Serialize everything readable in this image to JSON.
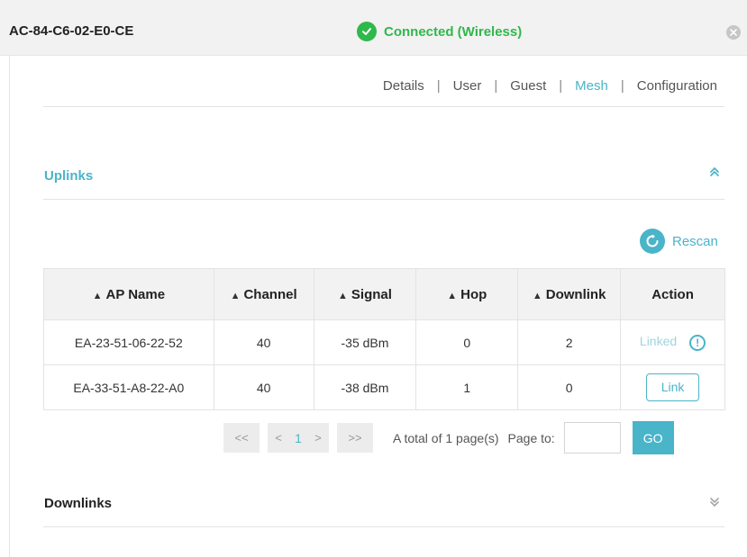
{
  "header": {
    "device_name": "AC-84-C6-02-E0-CE",
    "status": "Connected (Wireless)"
  },
  "tabs": [
    {
      "label": "Details",
      "active": false
    },
    {
      "label": "User",
      "active": false
    },
    {
      "label": "Guest",
      "active": false
    },
    {
      "label": "Mesh",
      "active": true
    },
    {
      "label": "Configuration",
      "active": false
    }
  ],
  "uplinks": {
    "title": "Uplinks",
    "rescan_label": "Rescan",
    "columns": [
      "AP Name",
      "Channel",
      "Signal",
      "Hop",
      "Downlink",
      "Action"
    ],
    "rows": [
      {
        "ap_name": "EA-23-51-06-22-52",
        "channel": "40",
        "signal": "-35 dBm",
        "hop": "0",
        "downlink": "2",
        "action": "Linked"
      },
      {
        "ap_name": "EA-33-51-A8-22-A0",
        "channel": "40",
        "signal": "-38 dBm",
        "hop": "1",
        "downlink": "0",
        "action": "Link"
      }
    ],
    "pagination": {
      "first": "<<",
      "prev": "<",
      "current_page": "1",
      "next": ">",
      "last": ">>",
      "total_text": "A total of 1 page(s)",
      "page_to_label": "Page to:",
      "page_input_value": "",
      "go_label": "GO"
    }
  },
  "downlinks": {
    "title": "Downlinks"
  },
  "colors": {
    "accent": "#4ab4c9",
    "connected": "#2fb84b",
    "header_bg": "#f2f2f2"
  },
  "icons": {
    "status": "check-circle-icon",
    "close": "close-circle-icon",
    "collapse": "chevron-double-up-icon",
    "expand": "chevron-double-down-icon",
    "rescan": "refresh-icon",
    "sort": "sort-icon",
    "info": "info-circle-icon"
  }
}
